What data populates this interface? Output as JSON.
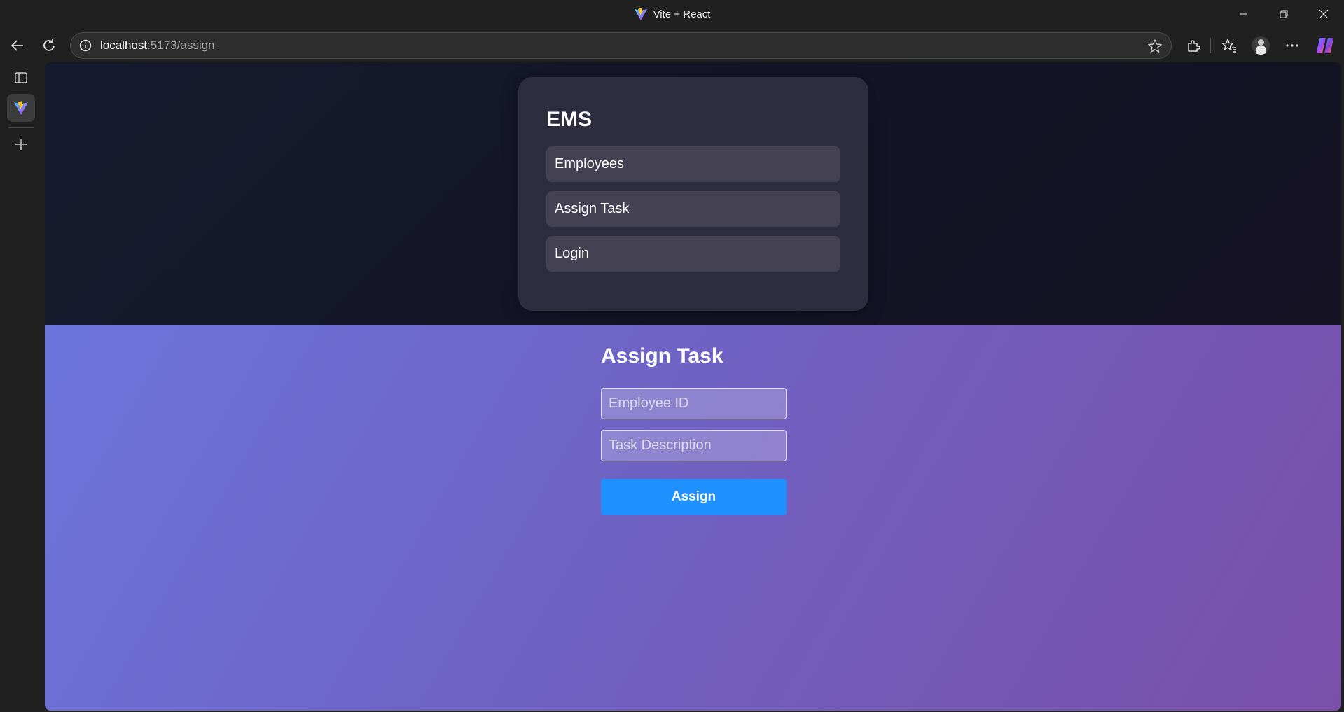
{
  "window": {
    "title": "Vite + React",
    "controls": {
      "minimize": "minimize-icon",
      "restore": "restore-icon",
      "close": "close-icon"
    }
  },
  "toolbar": {
    "url_host": "localhost",
    "url_path": ":5173/assign",
    "icons": [
      "back-icon",
      "refresh-icon",
      "info-icon",
      "star-icon",
      "extensions-icon",
      "favorites-icon",
      "profile-icon",
      "more-icon",
      "copilot-icon"
    ]
  },
  "siderail": {
    "icons": [
      "tab-actions-icon",
      "vite-tab-icon",
      "new-tab-icon"
    ]
  },
  "nav": {
    "brand": "EMS",
    "items": [
      {
        "label": "Employees"
      },
      {
        "label": "Assign Task"
      },
      {
        "label": "Login"
      }
    ]
  },
  "form": {
    "title": "Assign Task",
    "employee_id_placeholder": "Employee ID",
    "task_description_placeholder": "Task Description",
    "submit_label": "Assign"
  },
  "colors": {
    "accent_button": "#1e90ff",
    "gradient_start": "#6b75db",
    "gradient_end": "#7a4faa",
    "nav_card": "#2e2d3f"
  }
}
